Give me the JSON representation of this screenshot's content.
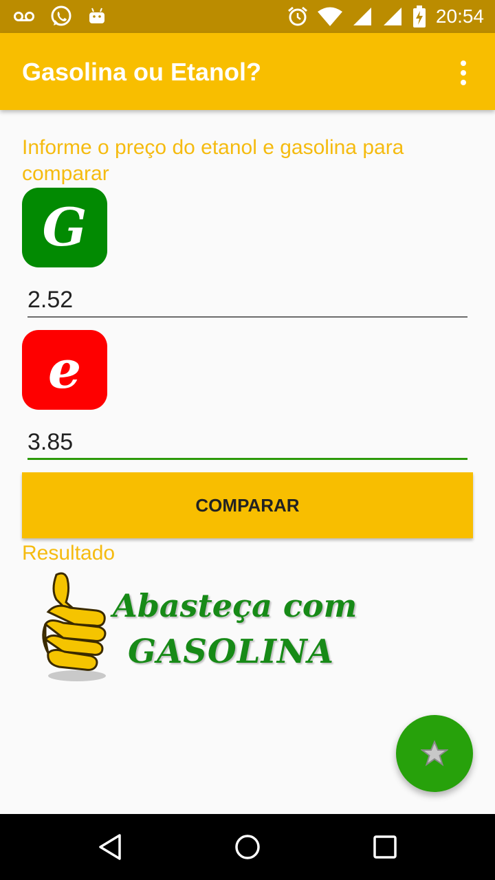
{
  "status_bar": {
    "time": "20:54",
    "icons": [
      "voicemail-icon",
      "whatsapp-icon",
      "android-icon",
      "alarm-icon",
      "wifi-icon",
      "signal-icon",
      "signal-icon",
      "battery-charging-icon"
    ]
  },
  "app_bar": {
    "title": "Gasolina ou Etanol?",
    "menu_icon": "overflow-menu-icon"
  },
  "form": {
    "instruction": "Informe o preço do etanol e gasolina para comparar",
    "gasoline_icon_letter": "G",
    "gasoline_value": "2.52",
    "ethanol_icon_letter": "e",
    "ethanol_value": "3.85",
    "compare_label": "COMPARAR"
  },
  "result": {
    "label": "Resultado",
    "image_line1": "Abasteça com",
    "image_line2": "GASOLINA"
  },
  "fab": {
    "icon": "star-icon"
  },
  "nav_bar": {
    "icons": [
      "back-icon",
      "home-icon",
      "recents-icon"
    ]
  },
  "colors": {
    "primary": "#f8be00",
    "status_bar": "#bb8c00",
    "accent_text": "#f5bb10",
    "gasoline": "#028a02",
    "ethanol": "#fe0000",
    "fab": "#27a10b"
  }
}
